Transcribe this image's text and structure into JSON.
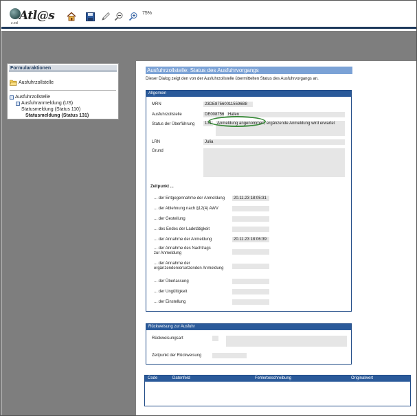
{
  "app": {
    "logo_text": "Atl@s",
    "logo_sub": "z.esl",
    "zoom": "75%",
    "toolbar_icons": [
      "home-icon",
      "save-icon",
      "pencil-icon",
      "zoom-out-icon",
      "zoom-in-icon"
    ]
  },
  "left_panel": {
    "title": "Formularaktionen",
    "action": "Ausfuhrzollstelle",
    "tree": {
      "root": "Ausfuhrzollstelle",
      "child": "Ausfuhranmeldung (US)",
      "status_110": "Statusmeldung (Status 110)",
      "status_131": "Statusmeldung (Status 131)"
    }
  },
  "document": {
    "title": "Ausfuhrzollstelle: Status des Ausfuhrvorgangs",
    "description": "Dieser Dialog zeigt den von der Ausfuhrzollstelle übermittelten Status des Ausfuhrvorgangs an.",
    "allgemein": {
      "heading": "Allgemein",
      "mrn_label": "MRN",
      "mrn_value": "23DE875600115596B8",
      "zollstelle_label": "Ausfuhrzollstelle",
      "zollstelle_code": "DE008756",
      "zollstelle_name": "Hafen",
      "status_label": "Status der Überführung",
      "status_code": "131",
      "status_text": "Anmeldung angenommen, ergänzende Anmeldung wird erwartet",
      "lrn_label": "LRN",
      "lrn_value": "Julia",
      "grund_label": "Grund",
      "zeitpunkt_heading": "Zeitpunkt ...",
      "zeitpunkte": [
        {
          "label": "... der Entgegennahme der Anmeldung",
          "value": "20.11.23 18:05:31"
        },
        {
          "label": "... der Ablehnung nach §12(4) AWV",
          "value": ""
        },
        {
          "label": "... der Gestellung",
          "value": ""
        },
        {
          "label": "... des Endes der Ladetätigkeit",
          "value": ""
        },
        {
          "label": "... der Annahme der Anmeldung",
          "value": "20.11.23 18:06:39"
        },
        {
          "label": "... der Annahme des Nachtrags",
          "label2": "zur Anmeldung",
          "value": ""
        },
        {
          "label": "... der Annahme der",
          "label2": "ergänzenden/ersetzenden Anmeldung",
          "value": ""
        },
        {
          "label": "... der Überlassung",
          "value": ""
        },
        {
          "label": "... der Ungültigkeit",
          "value": ""
        },
        {
          "label": "... der Einstellung",
          "value": ""
        }
      ]
    },
    "rueckweisung": {
      "heading": "Rückweisung zur Ausfuhr",
      "art_label": "Rückweisungsart",
      "zeitpunkt_label": "Zeitpunkt der Rückweisung"
    },
    "fehler_grid": {
      "columns": [
        "Code",
        "Datenfeld",
        "Fehlerbeschreibung",
        "Originalwert"
      ]
    }
  }
}
